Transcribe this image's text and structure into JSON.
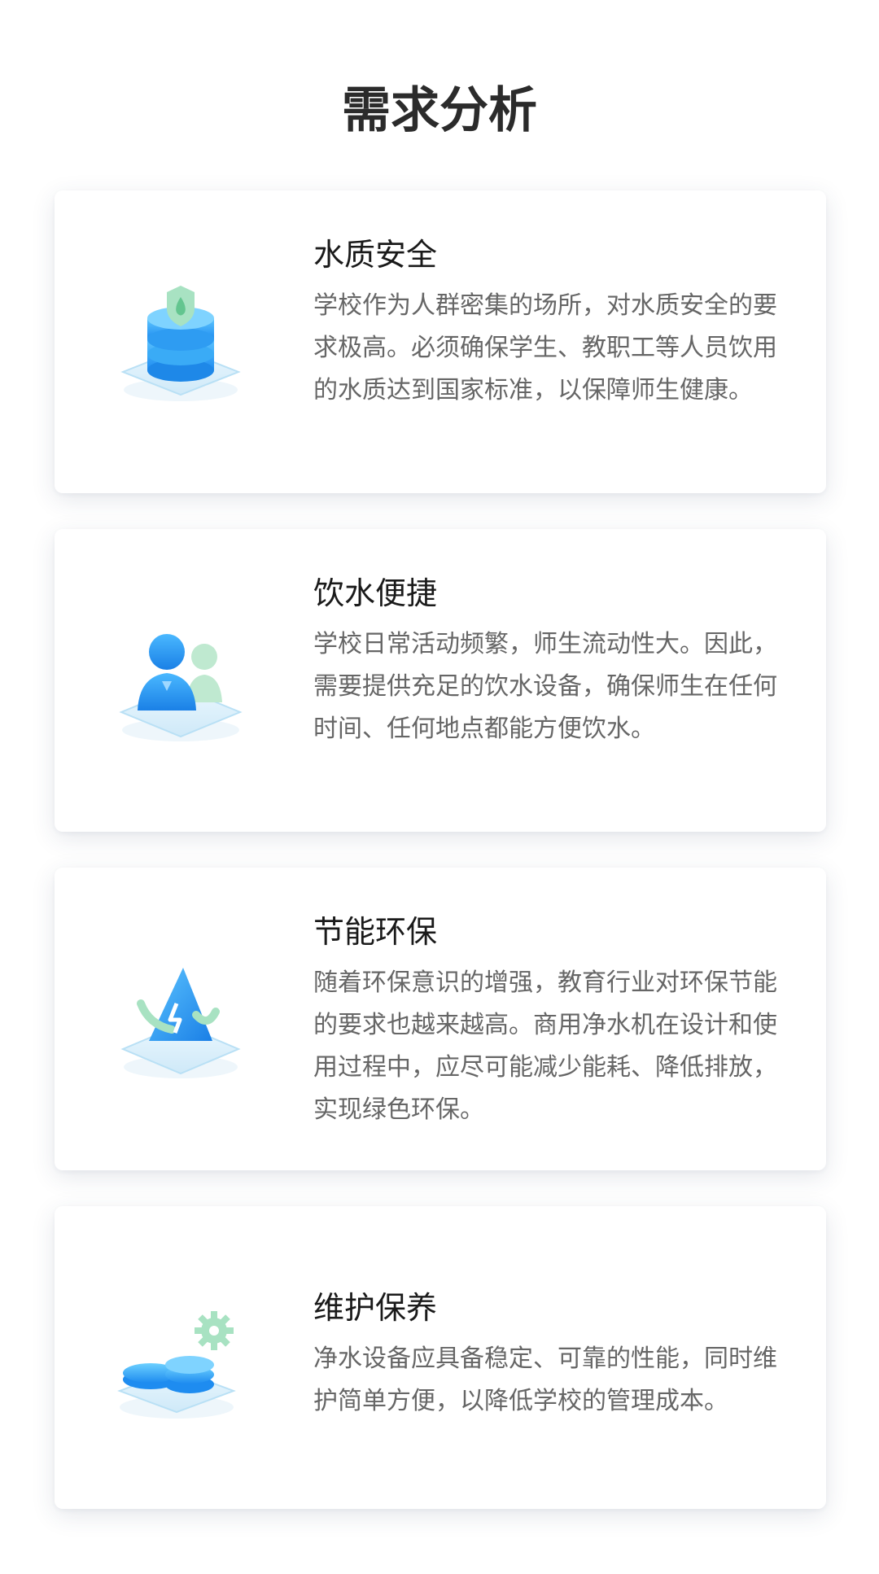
{
  "page": {
    "title": "需求分析"
  },
  "cards": [
    {
      "icon": "water-quality-shield-icon",
      "title": "水质安全",
      "description": "学校作为人群密集的场所，对水质安全的要求极高。必须确保学生、教职工等人员饮用的水质达到国家标准，以保障师生健康。"
    },
    {
      "icon": "people-24h-icon",
      "title": "饮水便捷",
      "description": "学校日常活动频繁，师生流动性大。因此，需要提供充足的饮水设备，确保师生在任何时间、任何地点都能方便饮水。"
    },
    {
      "icon": "eco-recycle-icon",
      "title": "节能环保",
      "description": "随着环保意识的增强，教育行业对环保节能的要求也越来越高。商用净水机在设计和使用过程中，应尽可能减少能耗、降低排放，实现绿色环保。"
    },
    {
      "icon": "maintenance-gear-icon",
      "title": "维护保养",
      "description": "净水设备应具备稳定、可靠的性能，同时维护简单方便，以降低学校的管理成本。"
    }
  ],
  "colors": {
    "accent_blue": "#1e9cf2",
    "accent_green": "#9bdcb4",
    "platform": "#dff1fb"
  }
}
